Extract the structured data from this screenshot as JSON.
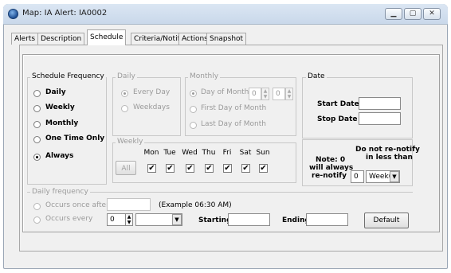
{
  "window": {
    "title": "Map: IA   Alert: IA0002",
    "controls": [
      "minimize-icon",
      "maximize-icon",
      "close-icon"
    ]
  },
  "tabs": [
    {
      "label": "Alerts"
    },
    {
      "label": "Description"
    },
    {
      "label": "Schedule",
      "active": true
    },
    {
      "label": "Criteria/Notify"
    },
    {
      "label": "Actions"
    },
    {
      "label": "Snapshot"
    }
  ],
  "schedule_frequency": {
    "title": "Schedule Frequency",
    "options": [
      {
        "label": "Daily",
        "checked": false
      },
      {
        "label": "Weekly",
        "checked": false
      },
      {
        "label": "Monthly",
        "checked": false
      },
      {
        "label": "One Time Only",
        "checked": false
      },
      {
        "label": "Always",
        "checked": true
      }
    ]
  },
  "daily": {
    "title": "Daily",
    "options": [
      {
        "label": "Every Day",
        "checked": true
      },
      {
        "label": "Weekdays",
        "checked": false
      }
    ]
  },
  "monthly": {
    "title": "Monthly",
    "options": [
      {
        "label": "Day of Month",
        "checked": true
      },
      {
        "label": "First Day of Month",
        "checked": false
      },
      {
        "label": "Last Day of Month",
        "checked": false
      }
    ],
    "day_value_1": "0",
    "day_value_2": "0"
  },
  "weekly": {
    "title": "Weekly",
    "all_button": "All",
    "days": [
      {
        "label": "Mon",
        "checked": true
      },
      {
        "label": "Tue",
        "checked": true
      },
      {
        "label": "Wed",
        "checked": true
      },
      {
        "label": "Thu",
        "checked": true
      },
      {
        "label": "Fri",
        "checked": true
      },
      {
        "label": "Sat",
        "checked": true
      },
      {
        "label": "Sun",
        "checked": true
      }
    ],
    "check_glyph": "✔"
  },
  "date": {
    "title": "Date",
    "start_label": "Start Date",
    "stop_label": "Stop Date",
    "start_value": "",
    "stop_value": ""
  },
  "renotify": {
    "note_line1": "Note: 0",
    "note_line2": "will always",
    "note_line3": "re-notify",
    "heading_line1": "Do not re-notify",
    "heading_line2": "in less than",
    "value": "0",
    "unit": "Week(s)"
  },
  "daily_frequency": {
    "title": "Daily frequency",
    "once_label": "Occurs once after",
    "once_value": "",
    "example": "(Example  06:30 AM)",
    "every_label": "Occurs every",
    "every_value": "0",
    "every_unit": "",
    "starting_label": "Starting",
    "starting_value": "",
    "ending_label": "Ending",
    "ending_value": "",
    "default_button": "Default"
  },
  "colors": {
    "titlebar": "#c9d8ea",
    "panel": "#f0f0f0",
    "disabled_text": "#9a9a9a"
  }
}
